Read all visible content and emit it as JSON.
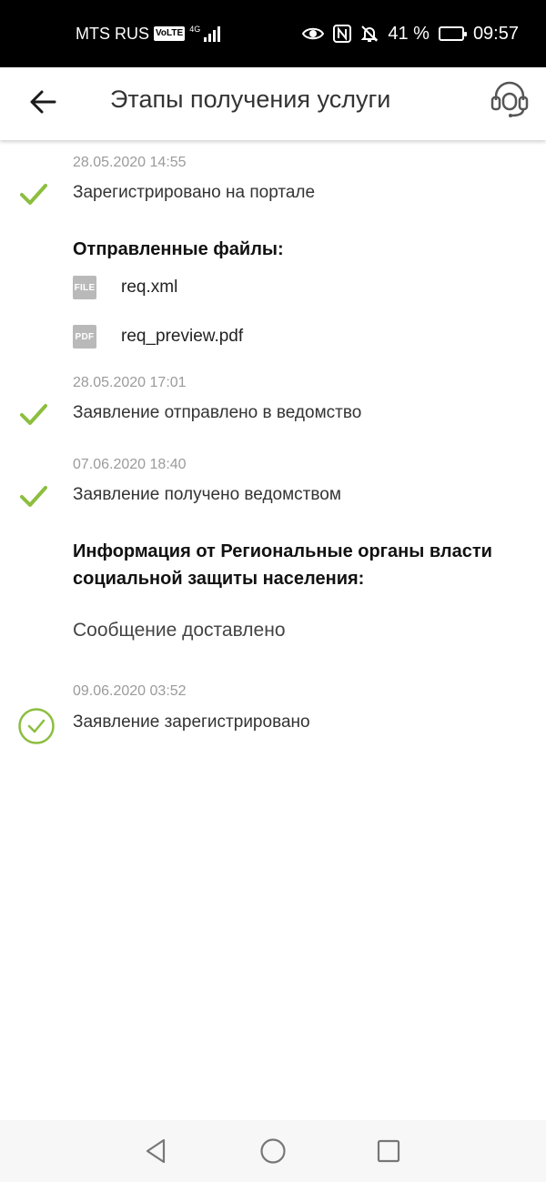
{
  "status_bar": {
    "carrier": "MTS RUS",
    "volte": "VoLTE",
    "network": "4G",
    "battery_percent": "41 %",
    "battery_level": 0.41,
    "time": "09:57"
  },
  "app_bar": {
    "title": "Этапы получения услуги"
  },
  "timeline": {
    "step1": {
      "timestamp": "28.05.2020 14:55",
      "text": "Зарегистрировано на портале"
    },
    "files": {
      "heading": "Отправленные файлы:",
      "items": [
        {
          "badge": "FILE",
          "name": "req.xml"
        },
        {
          "badge": "PDF",
          "name": "req_preview.pdf"
        }
      ]
    },
    "step2": {
      "timestamp": "28.05.2020 17:01",
      "text": "Заявление отправлено в ведомство"
    },
    "step3": {
      "timestamp": "07.06.2020 18:40",
      "text": "Заявление получено ведомством"
    },
    "info": {
      "heading_line1": "Информация от Региональные органы власти",
      "heading_line2": "социальной защиты населения:",
      "message": "Сообщение доставлено"
    },
    "step4": {
      "timestamp": "09.06.2020 03:52",
      "text": "Заявление зарегистрировано"
    }
  },
  "colors": {
    "check_green": "#8cbe3f",
    "timestamp_gray": "#9b9b9b"
  }
}
